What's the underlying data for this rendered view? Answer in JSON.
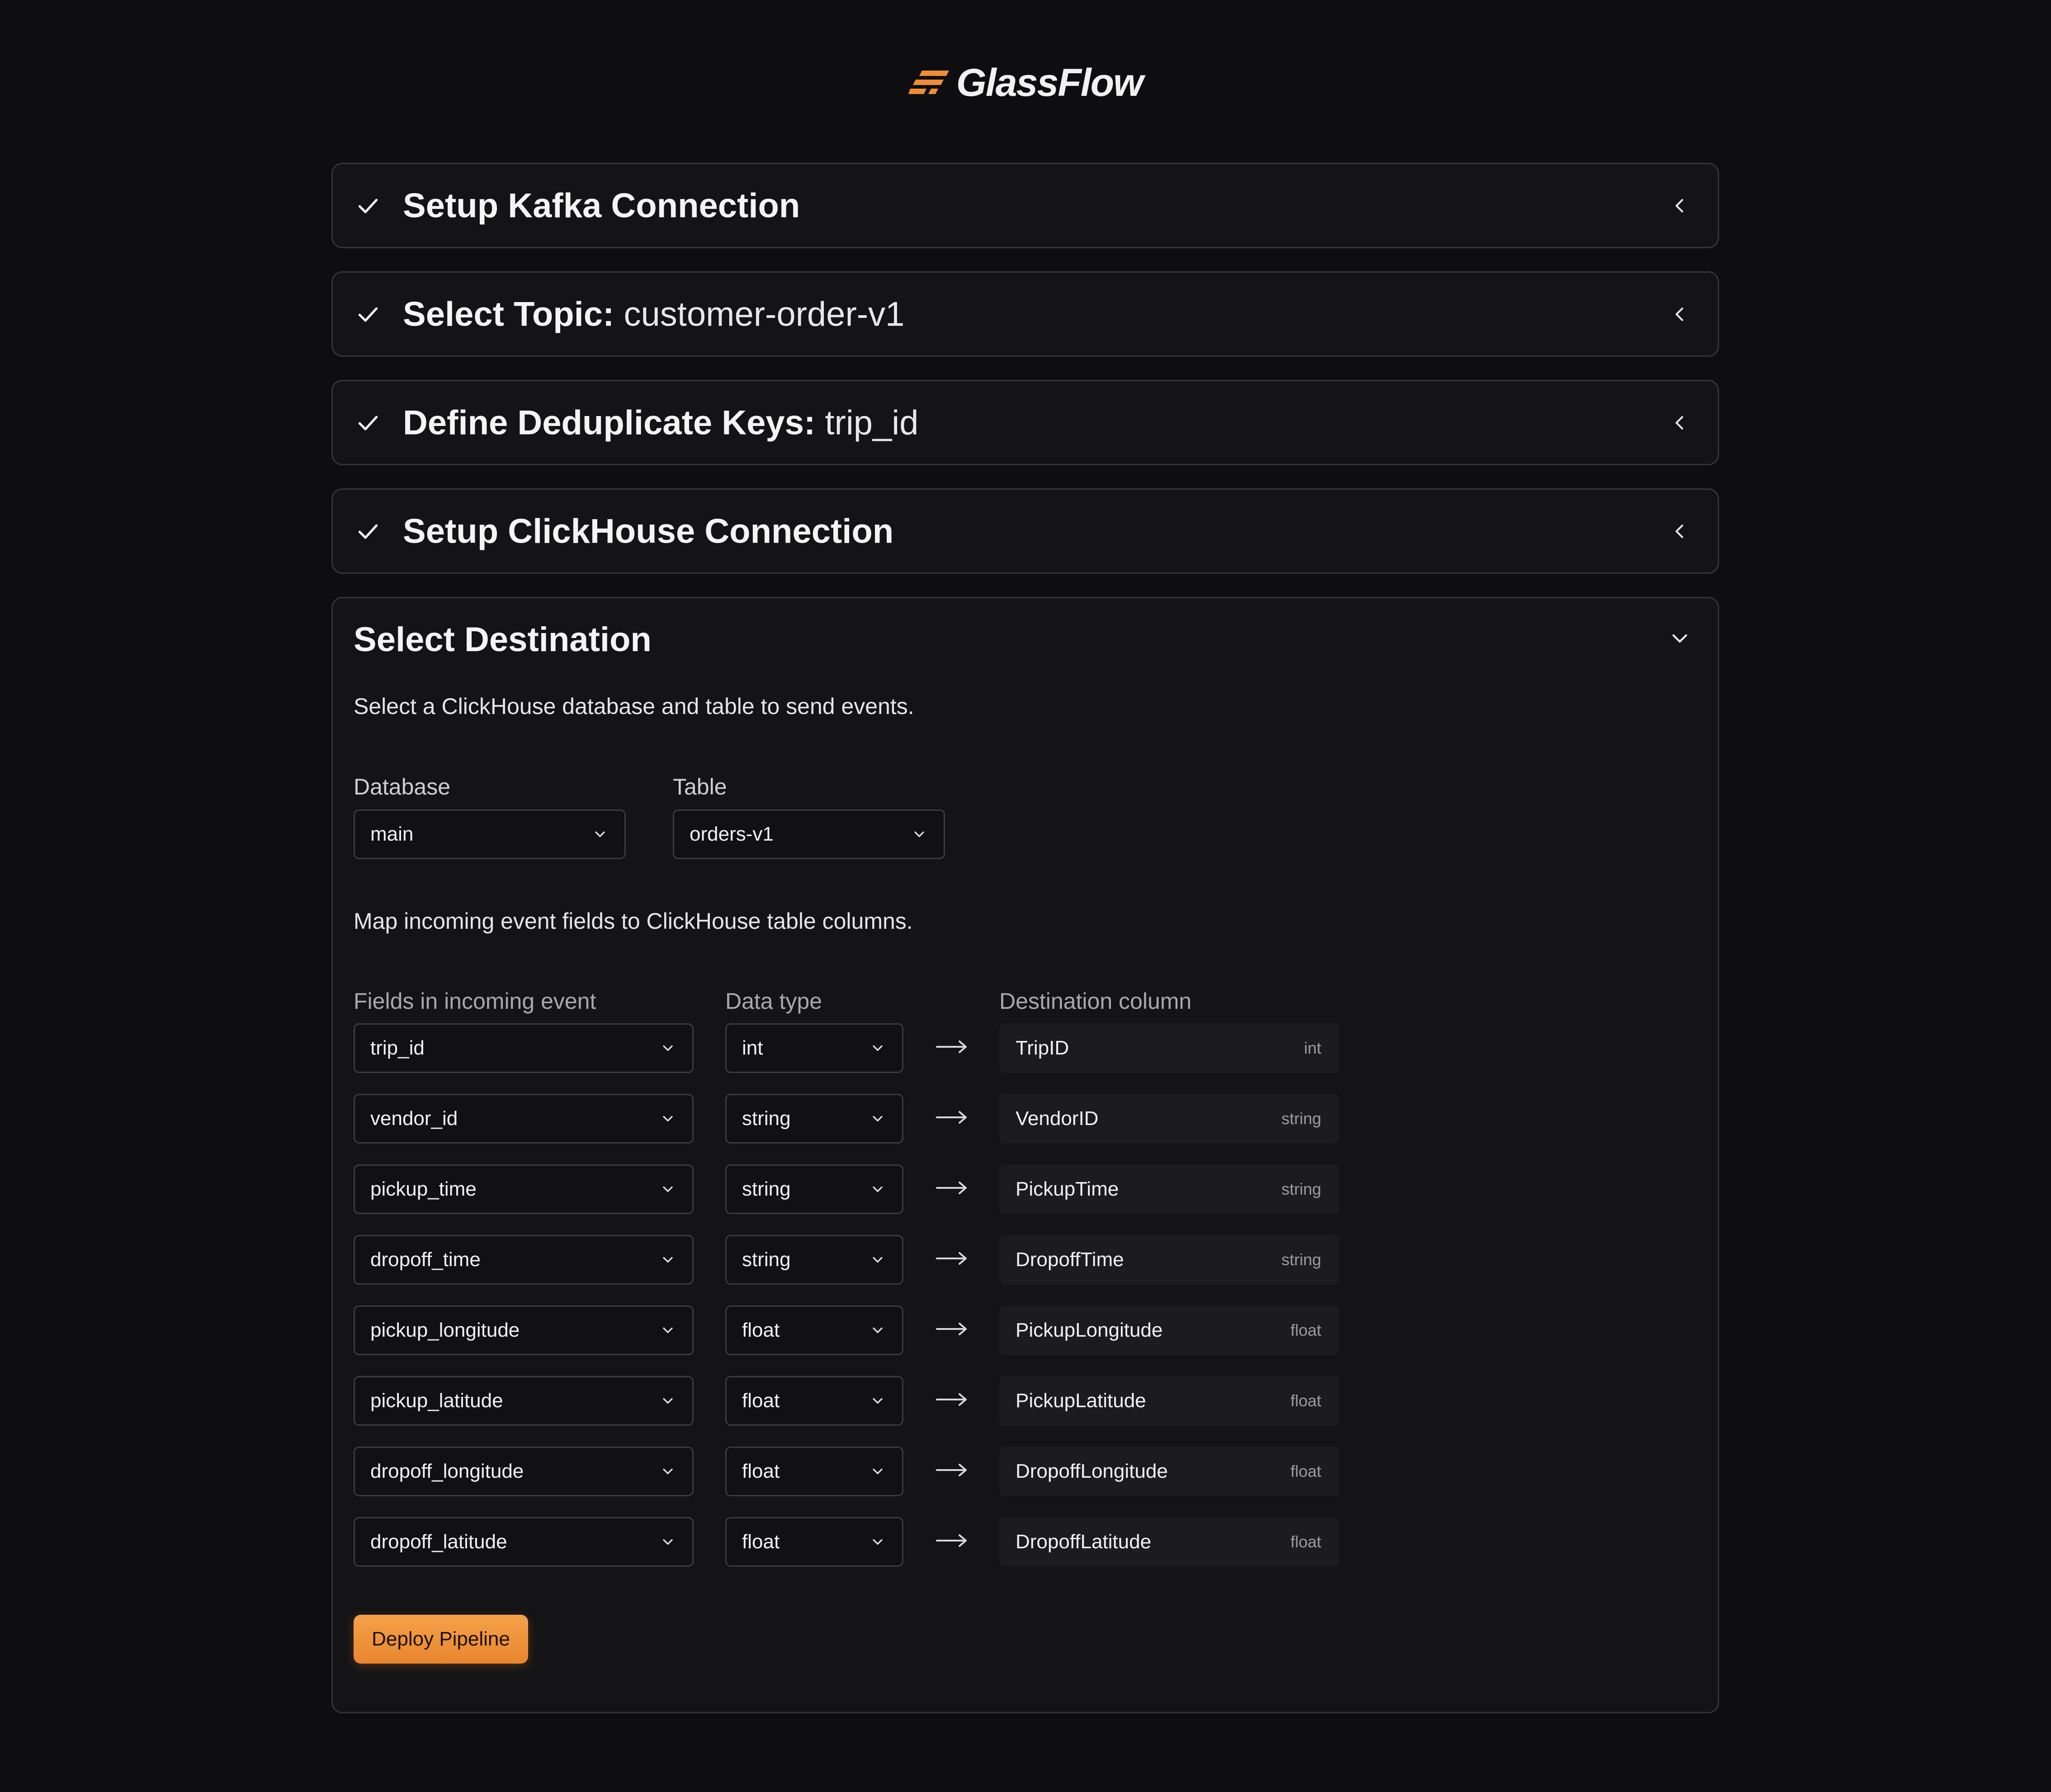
{
  "brand": {
    "name": "GlassFlow",
    "accent": "#ee8d35"
  },
  "steps": [
    {
      "label": "Setup Kafka Connection",
      "value": ""
    },
    {
      "label": "Select Topic:",
      "value": "customer-order-v1"
    },
    {
      "label": "Define Deduplicate Keys:",
      "value": "trip_id"
    },
    {
      "label": "Setup ClickHouse Connection",
      "value": ""
    }
  ],
  "destination": {
    "title": "Select Destination",
    "description": "Select a ClickHouse database and table to send events.",
    "database_label": "Database",
    "database_value": "main",
    "table_label": "Table",
    "table_value": "orders-v1",
    "mapping_description": "Map incoming event fields to ClickHouse table columns.",
    "headers": {
      "fields": "Fields in incoming event",
      "type": "Data type",
      "destination": "Destination column"
    },
    "rows": [
      {
        "field": "trip_id",
        "type": "int",
        "column": "TripID",
        "column_type": "int"
      },
      {
        "field": "vendor_id",
        "type": "string",
        "column": "VendorID",
        "column_type": "string"
      },
      {
        "field": "pickup_time",
        "type": "string",
        "column": "PickupTime",
        "column_type": "string"
      },
      {
        "field": "dropoff_time",
        "type": "string",
        "column": "DropoffTime",
        "column_type": "string"
      },
      {
        "field": "pickup_longitude",
        "type": "float",
        "column": "PickupLongitude",
        "column_type": "float"
      },
      {
        "field": "pickup_latitude",
        "type": "float",
        "column": "PickupLatitude",
        "column_type": "float"
      },
      {
        "field": "dropoff_longitude",
        "type": "float",
        "column": "DropoffLongitude",
        "column_type": "float"
      },
      {
        "field": "dropoff_latitude",
        "type": "float",
        "column": "DropoffLatitude",
        "column_type": "float"
      }
    ],
    "deploy_label": "Deploy Pipeline"
  }
}
